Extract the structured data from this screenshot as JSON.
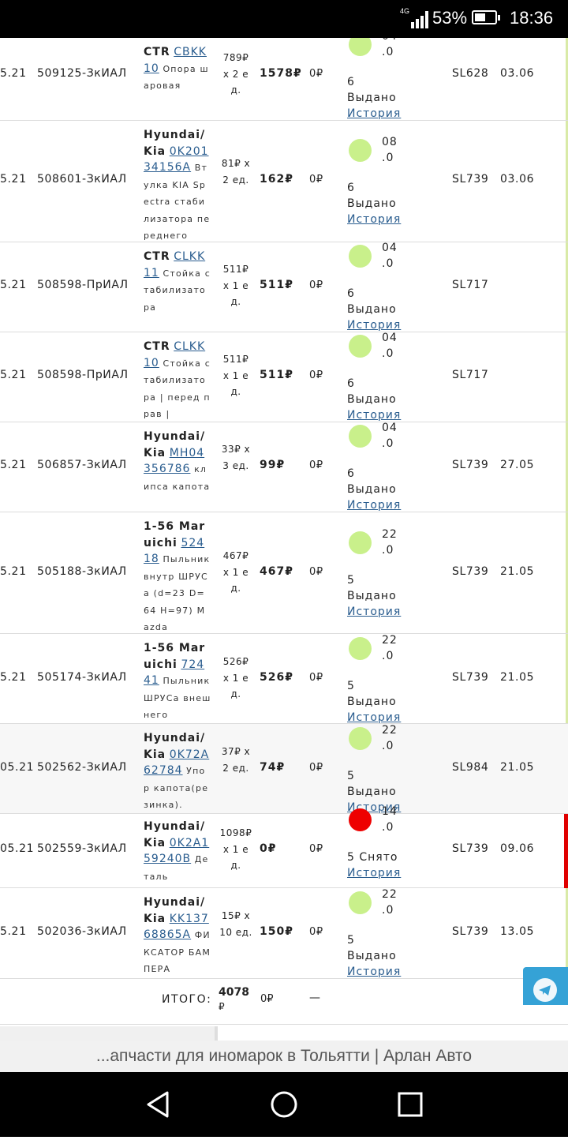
{
  "status_bar": {
    "network": "4G",
    "battery_percent": "53%",
    "battery_level": 0.53,
    "time": "18:36"
  },
  "rows": [
    {
      "date": "5.21",
      "number": "509125-ЗкИАЛ",
      "brand": "CTR",
      "code": "CBKK 10",
      "description": "Опора шаровая",
      "qty": "789₽ x 2 ед.",
      "sum": "1578₽",
      "discount": "0₽",
      "status_date_lines": [
        "04",
        ".0",
        "6"
      ],
      "status": "Выдано",
      "status_color": "#c9f08b",
      "history": "История",
      "sl": "SL628",
      "delivery": "03.06"
    },
    {
      "date": "5.21",
      "number": "508601-ЗкИАЛ",
      "brand": "Hyundai/Kia",
      "code": "0K20134156A",
      "description": "Втулка KIA Spectra стабилизатора переднего",
      "qty": "81₽ x 2 ед.",
      "sum": "162₽",
      "discount": "0₽",
      "status_date_lines": [
        "08",
        ".0",
        "6"
      ],
      "status": "Выдано",
      "status_color": "#c9f08b",
      "history": "История",
      "sl": "SL739",
      "delivery": "03.06"
    },
    {
      "date": "5.21",
      "number": "508598-ПрИАЛ",
      "brand": "CTR",
      "code": "CLKK 11",
      "description": "Стойка стабилизатора",
      "qty": "511₽ x 1 ед.",
      "sum": "511₽",
      "discount": "0₽",
      "status_date_lines": [
        "04",
        ".0",
        "6"
      ],
      "status": "Выдано",
      "status_color": "#c9f08b",
      "history": "История",
      "sl": "SL717",
      "delivery": ""
    },
    {
      "date": "5.21",
      "number": "508598-ПрИАЛ",
      "brand": "CTR",
      "code": "CLKK 10",
      "description": "Стойка стабилизатора | перед прав |",
      "qty": "511₽ x 1 ед.",
      "sum": "511₽",
      "discount": "0₽",
      "status_date_lines": [
        "04",
        ".0",
        "6"
      ],
      "status": "Выдано",
      "status_color": "#c9f08b",
      "history": "История",
      "sl": "SL717",
      "delivery": ""
    },
    {
      "date": "5.21",
      "number": "506857-ЗкИАЛ",
      "brand": "Hyundai/Kia",
      "code": "MH04356786",
      "description": "клипса капота",
      "qty": "33₽ x 3 ед.",
      "sum": "99₽",
      "discount": "0₽",
      "status_date_lines": [
        "04",
        ".0",
        "6"
      ],
      "status": "Выдано",
      "status_color": "#c9f08b",
      "history": "История",
      "sl": "SL739",
      "delivery": "27.05"
    },
    {
      "date": "5.21",
      "number": "505188-ЗкИАЛ",
      "brand": "1-56 Maruichi",
      "code": "52418",
      "description": "Пыльник внутр ШРУСа (d=23 D=64 H=97) Mazda",
      "qty": "467₽ x 1 ед.",
      "sum": "467₽",
      "discount": "0₽",
      "status_date_lines": [
        "22",
        ".0",
        "5"
      ],
      "status": "Выдано",
      "status_color": "#c9f08b",
      "history": "История",
      "sl": "SL739",
      "delivery": "21.05"
    },
    {
      "date": "5.21",
      "number": "505174-ЗкИАЛ",
      "brand": "1-56 Maruichi",
      "code": "72441",
      "description": "Пыльник ШРУСа внешнего",
      "qty": "526₽ x 1 ед.",
      "sum": "526₽",
      "discount": "0₽",
      "status_date_lines": [
        "22",
        ".0",
        "5"
      ],
      "status": "Выдано",
      "status_color": "#c9f08b",
      "history": "История",
      "sl": "SL739",
      "delivery": "21.05"
    },
    {
      "date": "05.21",
      "number": "502562-ЗкИАЛ",
      "brand": "Hyundai/Kia",
      "code": "0K72A62784",
      "description": "Упор капота(резинка).",
      "qty": "37₽ x 2 ед.",
      "sum": "74₽",
      "discount": "0₽",
      "status_date_lines": [
        "22",
        ".0",
        "5"
      ],
      "status": "Выдано",
      "status_color": "#c9f08b",
      "history": "История",
      "sl": "SL984",
      "delivery": "21.05"
    },
    {
      "date": "05.21",
      "number": "502559-ЗкИАЛ",
      "brand": "Hyundai/Kia",
      "code": "0K2A159240B",
      "description": "Деталь",
      "qty": "1098₽ x 1 ед.",
      "sum": "0₽",
      "discount": "0₽",
      "status_date_lines": [
        "14",
        ".0",
        "5"
      ],
      "status": "Снято",
      "status_color": "#ee0000",
      "history": "История",
      "sl": "SL739",
      "delivery": "09.06"
    },
    {
      "date": "5.21",
      "number": "502036-ЗкИАЛ",
      "brand": "Hyundai/Kia",
      "code": "KK13768865A",
      "description": "ФИКСАТОР БАМПЕРА",
      "qty": "15₽ x 10 ед.",
      "sum": "150₽",
      "discount": "0₽",
      "status_date_lines": [
        "22",
        ".0",
        "5"
      ],
      "status": "Выдано",
      "status_color": "#c9f08b",
      "history": "История",
      "sl": "SL739",
      "delivery": "13.05"
    }
  ],
  "totals": {
    "label": "ИТОГО:",
    "sum": "4078",
    "currency": "₽",
    "discount": "0₽",
    "dash": "—"
  },
  "footer": {
    "page_title": "...апчасти для иномарок в Тольятти | Арлан Авто"
  }
}
